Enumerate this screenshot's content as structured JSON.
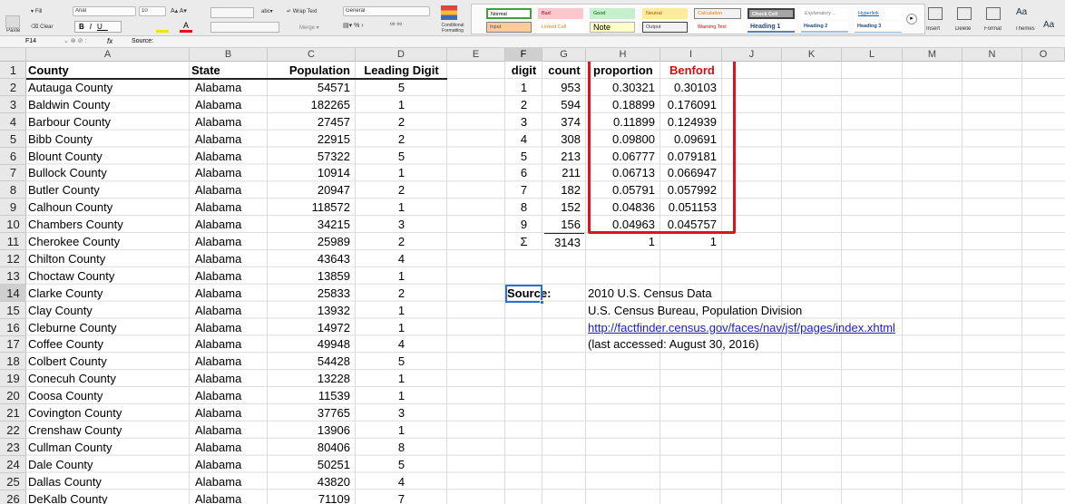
{
  "ribbon": {
    "font_name": "Arial",
    "font_size": "10",
    "fill_label": "Fill",
    "clear_label": "Clear",
    "paste_label": "Paste",
    "wrap_text": "Wrap Text",
    "merge": "Merge",
    "number_format": "General",
    "conditional_formatting": "Conditional Formatting",
    "styles": [
      "Normal",
      "Bad",
      "Good",
      "Neutral",
      "Calculation",
      "Check Cell",
      "Explanatory ...",
      "Hyperlink",
      "Input",
      "Linked Cell",
      "Note",
      "Output",
      "Warning Text",
      "Heading 1",
      "Heading 2",
      "Heading 3"
    ],
    "cells": [
      "Insert",
      "Delete",
      "Format"
    ],
    "themes": "Themes",
    "themes_aa": "Aa"
  },
  "formula_bar": {
    "name_box": "F14",
    "fx": "fx",
    "content": "Source:"
  },
  "columns": [
    "A",
    "B",
    "C",
    "D",
    "E",
    "F",
    "G",
    "H",
    "I",
    "J",
    "K",
    "L",
    "M",
    "N",
    "O"
  ],
  "selected_column": "F",
  "selected_row": "14",
  "rows": [
    "1",
    "2",
    "3",
    "4",
    "5",
    "6",
    "7",
    "8",
    "9",
    "10",
    "11",
    "12",
    "13",
    "14",
    "15",
    "16",
    "17",
    "18",
    "19",
    "20",
    "21",
    "22",
    "23",
    "24",
    "25",
    "26"
  ],
  "table_headers": {
    "county": "County",
    "state": "State",
    "population": "Population",
    "leading_digit": "Leading Digit"
  },
  "counties": [
    {
      "county": "Autauga County",
      "state": "Alabama",
      "pop": "54571",
      "digit": "5"
    },
    {
      "county": "Baldwin County",
      "state": "Alabama",
      "pop": "182265",
      "digit": "1"
    },
    {
      "county": "Barbour County",
      "state": "Alabama",
      "pop": "27457",
      "digit": "2"
    },
    {
      "county": "Bibb County",
      "state": "Alabama",
      "pop": "22915",
      "digit": "2"
    },
    {
      "county": "Blount County",
      "state": "Alabama",
      "pop": "57322",
      "digit": "5"
    },
    {
      "county": "Bullock County",
      "state": "Alabama",
      "pop": "10914",
      "digit": "1"
    },
    {
      "county": "Butler County",
      "state": "Alabama",
      "pop": "20947",
      "digit": "2"
    },
    {
      "county": "Calhoun County",
      "state": "Alabama",
      "pop": "118572",
      "digit": "1"
    },
    {
      "county": "Chambers County",
      "state": "Alabama",
      "pop": "34215",
      "digit": "3"
    },
    {
      "county": "Cherokee County",
      "state": "Alabama",
      "pop": "25989",
      "digit": "2"
    },
    {
      "county": "Chilton County",
      "state": "Alabama",
      "pop": "43643",
      "digit": "4"
    },
    {
      "county": "Choctaw County",
      "state": "Alabama",
      "pop": "13859",
      "digit": "1"
    },
    {
      "county": "Clarke County",
      "state": "Alabama",
      "pop": "25833",
      "digit": "2"
    },
    {
      "county": "Clay County",
      "state": "Alabama",
      "pop": "13932",
      "digit": "1"
    },
    {
      "county": "Cleburne County",
      "state": "Alabama",
      "pop": "14972",
      "digit": "1"
    },
    {
      "county": "Coffee County",
      "state": "Alabama",
      "pop": "49948",
      "digit": "4"
    },
    {
      "county": "Colbert County",
      "state": "Alabama",
      "pop": "54428",
      "digit": "5"
    },
    {
      "county": "Conecuh County",
      "state": "Alabama",
      "pop": "13228",
      "digit": "1"
    },
    {
      "county": "Coosa County",
      "state": "Alabama",
      "pop": "11539",
      "digit": "1"
    },
    {
      "county": "Covington County",
      "state": "Alabama",
      "pop": "37765",
      "digit": "3"
    },
    {
      "county": "Crenshaw County",
      "state": "Alabama",
      "pop": "13906",
      "digit": "1"
    },
    {
      "county": "Cullman County",
      "state": "Alabama",
      "pop": "80406",
      "digit": "8"
    },
    {
      "county": "Dale County",
      "state": "Alabama",
      "pop": "50251",
      "digit": "5"
    },
    {
      "county": "Dallas County",
      "state": "Alabama",
      "pop": "43820",
      "digit": "4"
    },
    {
      "county": "DeKalb County",
      "state": "Alabama",
      "pop": "71109",
      "digit": "7"
    }
  ],
  "benford_headers": {
    "digit": "digit",
    "count": "count",
    "proportion": "proportion",
    "benford": "Benford"
  },
  "benford": [
    {
      "digit": "1",
      "count": "953",
      "proportion": "0.30321",
      "benford": "0.30103"
    },
    {
      "digit": "2",
      "count": "594",
      "proportion": "0.18899",
      "benford": "0.176091"
    },
    {
      "digit": "3",
      "count": "374",
      "proportion": "0.11899",
      "benford": "0.124939"
    },
    {
      "digit": "4",
      "count": "308",
      "proportion": "0.09800",
      "benford": "0.09691"
    },
    {
      "digit": "5",
      "count": "213",
      "proportion": "0.06777",
      "benford": "0.079181"
    },
    {
      "digit": "6",
      "count": "211",
      "proportion": "0.06713",
      "benford": "0.066947"
    },
    {
      "digit": "7",
      "count": "182",
      "proportion": "0.05791",
      "benford": "0.057992"
    },
    {
      "digit": "8",
      "count": "152",
      "proportion": "0.04836",
      "benford": "0.051153"
    },
    {
      "digit": "9",
      "count": "156",
      "proportion": "0.04963",
      "benford": "0.045757"
    }
  ],
  "totals": {
    "sigma": "Σ",
    "count": "3143",
    "proportion": "1",
    "benford": "1"
  },
  "source": {
    "label": "Source:",
    "line1": "2010 U.S. Census Data",
    "line2": "U.S. Census Bureau,  Population Division",
    "link": "http://factfinder.census.gov/faces/nav/jsf/pages/index.xhtml",
    "line4": "(last accessed: August 30, 2016)"
  },
  "colors": {
    "highlight_border": "#e0131c",
    "benford_header": "#d40e0e",
    "link": "#1a1ad6",
    "selection": "#2a6fd6"
  }
}
